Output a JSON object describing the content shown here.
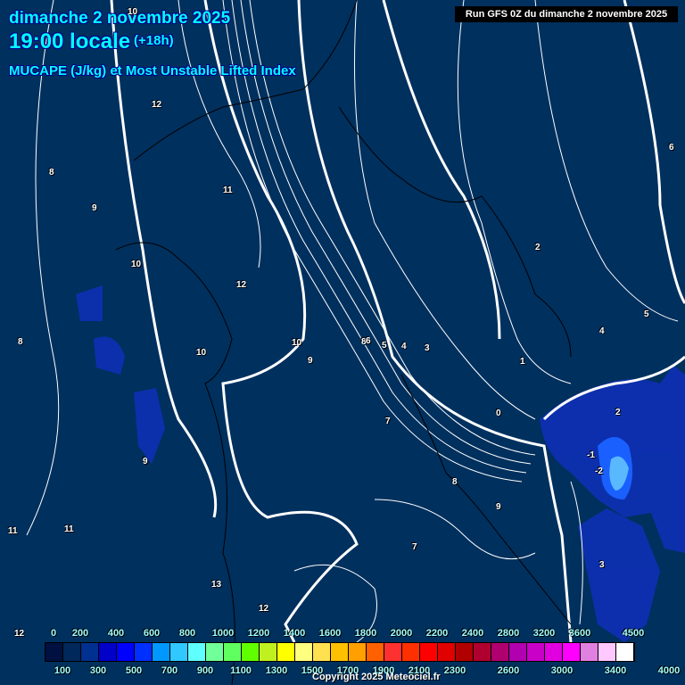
{
  "header": {
    "date": "dimanche 2 novembre 2025",
    "time": "19:00 locale",
    "lead": "(+18h)",
    "parameter": "MUCAPE (J/kg) et Most Unstable Lifted Index",
    "run": "Run GFS 0Z du dimanche 2 novembre 2025"
  },
  "legend": {
    "colors": [
      "#001040",
      "#00285a",
      "#003090",
      "#0000c8",
      "#0000ff",
      "#0030ff",
      "#0098ff",
      "#30c8ff",
      "#60ffff",
      "#70ff98",
      "#60ff60",
      "#60ff00",
      "#c0f020",
      "#ffff00",
      "#ffff80",
      "#ffe050",
      "#ffc000",
      "#ffa000",
      "#ff6000",
      "#ff3030",
      "#ff3000",
      "#ff0000",
      "#e00000",
      "#b00000",
      "#b00030",
      "#b00070",
      "#b000b0",
      "#c800c8",
      "#e000e0",
      "#ff00ff",
      "#e080e0",
      "#ffc8ff",
      "#ffffff"
    ],
    "top_labels": [
      "0",
      "200",
      "400",
      "600",
      "800",
      "1000",
      "1200",
      "1400",
      "1600",
      "1800",
      "2000",
      "2200",
      "2400",
      "2800",
      "3200",
      "3600",
      "4500"
    ],
    "bottom_labels": [
      "100",
      "300",
      "500",
      "700",
      "900",
      "1100",
      "1300",
      "1500",
      "1700",
      "1900",
      "2100",
      "2300",
      "2600",
      "3000",
      "3400",
      "4000"
    ]
  },
  "lifted_index_labels": [
    "10",
    "12",
    "8",
    "9",
    "10",
    "12",
    "10",
    "8",
    "9",
    "11",
    "11",
    "13",
    "12",
    "10",
    "9",
    "8",
    "7",
    "6",
    "5",
    "4",
    "3",
    "2",
    "1",
    "0",
    "-1",
    "-2",
    "2",
    "3",
    "4",
    "5",
    "6",
    "8",
    "9",
    "7",
    "11",
    "12"
  ],
  "copyright": "Copyright 2025 Meteociel.fr"
}
